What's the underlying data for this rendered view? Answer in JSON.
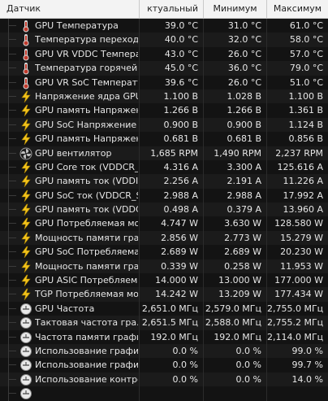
{
  "header": {
    "sensor": "Датчик",
    "current": "ктуальный",
    "min": "Минимум",
    "max": "Максимум"
  },
  "rows": [
    {
      "icon": "thermometer-icon",
      "label": "GPU Температура",
      "cur": "39.0 °C",
      "min": "31.0 °C",
      "max": "61.0 °C"
    },
    {
      "icon": "thermometer-icon",
      "label": "Температура перехода...",
      "cur": "40.0 °C",
      "min": "32.0 °C",
      "max": "58.0 °C"
    },
    {
      "icon": "thermometer-icon",
      "label": "GPU VR VDDC Температ...",
      "cur": "43.0 °C",
      "min": "26.0 °C",
      "max": "57.0 °C"
    },
    {
      "icon": "thermometer-icon",
      "label": "Температура горячей т...",
      "cur": "45.0 °C",
      "min": "36.0 °C",
      "max": "79.0 °C"
    },
    {
      "icon": "thermometer-icon",
      "label": "GPU VR SoC Температура",
      "cur": "39.6 °C",
      "min": "26.0 °C",
      "max": "51.0 °C"
    },
    {
      "icon": "lightning-icon",
      "label": "Напряжение ядра GPU ...",
      "cur": "1.100 В",
      "min": "1.028 В",
      "max": "1.100 В"
    },
    {
      "icon": "lightning-icon",
      "label": "GPU память Напряжени...",
      "cur": "1.266 В",
      "min": "1.266 В",
      "max": "1.361 В"
    },
    {
      "icon": "lightning-icon",
      "label": "GPU SoC Напряжение (...",
      "cur": "0.900 В",
      "min": "0.900 В",
      "max": "1.124 В"
    },
    {
      "icon": "lightning-icon",
      "label": "GPU память Напряжени...",
      "cur": "0.681 В",
      "min": "0.681 В",
      "max": "0.856 В"
    },
    {
      "icon": "fan-icon",
      "label": "GPU вентилятор",
      "cur": "1,685 RPM",
      "min": "1,490 RPM",
      "max": "2,237 RPM"
    },
    {
      "icon": "lightning-icon",
      "label": "GPU Core ток (VDDCR_...",
      "cur": "4.316 A",
      "min": "3.300 A",
      "max": "125.616 A"
    },
    {
      "icon": "lightning-icon",
      "label": "GPU память ток (VDDIO)",
      "cur": "2.256 A",
      "min": "2.191 A",
      "max": "11.226 A"
    },
    {
      "icon": "lightning-icon",
      "label": "GPU SoC ток (VDDCR_S...",
      "cur": "2.988 A",
      "min": "2.988 A",
      "max": "17.992 A"
    },
    {
      "icon": "lightning-icon",
      "label": "GPU память ток (VDDCI...",
      "cur": "0.498 A",
      "min": "0.379 A",
      "max": "13.960 A"
    },
    {
      "icon": "lightning-icon",
      "label": "GPU Потребляемая мощ...",
      "cur": "4.747 W",
      "min": "3.630 W",
      "max": "128.580 W"
    },
    {
      "icon": "lightning-icon",
      "label": "Мощность памяти граф...",
      "cur": "2.856 W",
      "min": "2.773 W",
      "max": "15.279 W"
    },
    {
      "icon": "lightning-icon",
      "label": "GPU SoC Потребляемая...",
      "cur": "2.689 W",
      "min": "2.689 W",
      "max": "20.230 W"
    },
    {
      "icon": "lightning-icon",
      "label": "Мощность памяти граф...",
      "cur": "0.339 W",
      "min": "0.258 W",
      "max": "11.953 W"
    },
    {
      "icon": "lightning-icon",
      "label": "GPU ASIC Потребляема...",
      "cur": "14.000 W",
      "min": "13.000 W",
      "max": "177.000 W"
    },
    {
      "icon": "lightning-icon",
      "label": "TGP Потребляемая мощ...",
      "cur": "14.242 W",
      "min": "13.209 W",
      "max": "177.434 W"
    },
    {
      "icon": "clock-icon",
      "label": "GPU Частота",
      "cur": "2,651.0 МГц",
      "min": "2,579.0 МГц",
      "max": "2,755.0 МГц"
    },
    {
      "icon": "clock-icon",
      "label": "Тактовая частота гра...",
      "cur": "2,651.5 МГц",
      "min": "2,588.0 МГц",
      "max": "2,755.2 МГц"
    },
    {
      "icon": "clock-icon",
      "label": "Частота памяти графи...",
      "cur": "192.0 МГц",
      "min": "192.0 МГц",
      "max": "2,114.0 МГц"
    },
    {
      "icon": "clock-icon",
      "label": "Использование графич...",
      "cur": "0.0 %",
      "min": "0.0 %",
      "max": "99.0 %"
    },
    {
      "icon": "clock-icon",
      "label": "Использование графич...",
      "cur": "0.0 %",
      "min": "0.0 %",
      "max": "99.7 %"
    },
    {
      "icon": "clock-icon",
      "label": "Использование контро...",
      "cur": "0.0 %",
      "min": "0.0 %",
      "max": "14.0 %"
    },
    {
      "icon": "clock-icon",
      "label": "",
      "cur": "",
      "min": "",
      "max": ""
    }
  ]
}
